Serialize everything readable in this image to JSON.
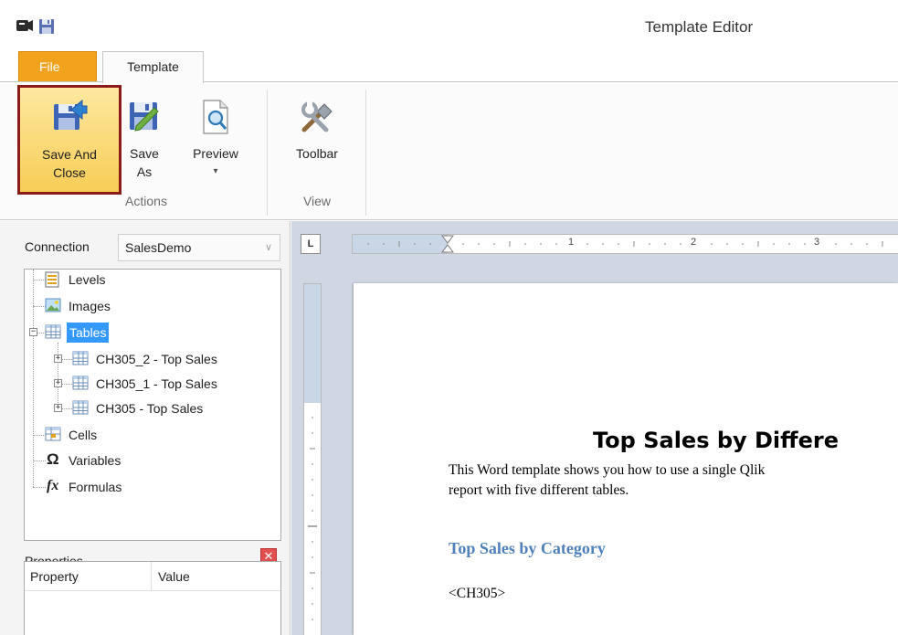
{
  "window": {
    "title": "Template Editor"
  },
  "quick_access": {
    "icons": [
      "app-icon",
      "save-icon"
    ]
  },
  "ribbon": {
    "tabs": [
      {
        "label": "File",
        "accent": "#f3a21d"
      },
      {
        "label": "Template",
        "active": true
      }
    ],
    "groups": [
      {
        "label": "Actions",
        "buttons": [
          {
            "label_line1": "Save And",
            "label_line2": "Close",
            "icon": "save-close-icon",
            "highlighted": true,
            "highlight_color": "#8b1a1a"
          },
          {
            "label_line1": "Save",
            "label_line2": "As",
            "icon": "save-as-icon"
          },
          {
            "label_line1": "Preview",
            "label_line2": "▾",
            "icon": "preview-icon"
          }
        ]
      },
      {
        "label": "View",
        "buttons": [
          {
            "label_line1": "Toolbar",
            "icon": "tools-icon"
          }
        ]
      }
    ]
  },
  "left_panel": {
    "connection": {
      "label": "Connection",
      "value": "SalesDemo"
    },
    "tree": [
      {
        "label": "Levels",
        "icon": "levels-icon"
      },
      {
        "label": "Images",
        "icon": "images-icon"
      },
      {
        "label": "Tables",
        "icon": "table-icon",
        "selected": true,
        "expanded": true,
        "children": [
          {
            "label": "CH305_2 -  Top Sales",
            "icon": "table-icon"
          },
          {
            "label": "CH305_1 -  Top Sales",
            "icon": "table-icon"
          },
          {
            "label": "CH305 -  Top Sales",
            "icon": "table-icon"
          }
        ]
      },
      {
        "label": "Cells",
        "icon": "cells-icon"
      },
      {
        "label": "Variables",
        "icon": "omega-icon"
      },
      {
        "label": "Formulas",
        "icon": "fx-icon"
      }
    ],
    "properties": {
      "title": "Properties",
      "columns": [
        "Property",
        "Value"
      ]
    }
  },
  "document": {
    "ruler_corner": "L",
    "ruler_numbers": [
      "1",
      "2",
      "3"
    ],
    "title": "Top Sales by Differe",
    "body_line1": "This Word template shows you how to use a single Qlik",
    "body_line2": "report with five different tables.",
    "heading": "Top Sales by Category",
    "tag": "<CH305>"
  },
  "colors": {
    "selection": "#3399ff",
    "heading_blue": "#4f81bd",
    "doc_background": "#cfd7e2"
  }
}
